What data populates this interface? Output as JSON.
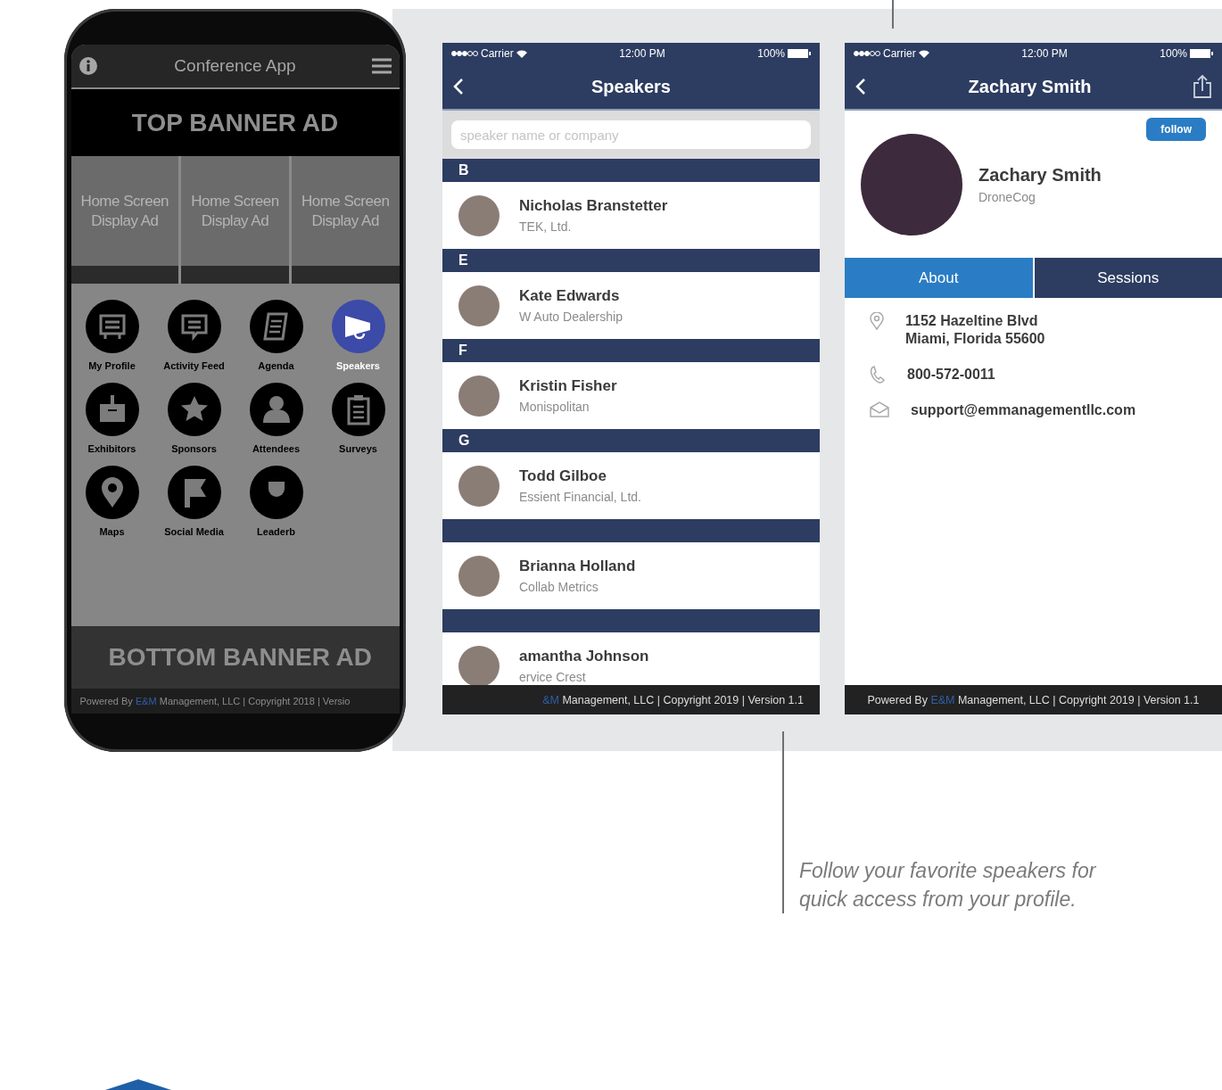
{
  "phone": {
    "header": {
      "title": "Conference App"
    },
    "top_banner": "TOP BANNER AD",
    "display_ads": [
      {
        "label": "Home Screen Display Ad"
      },
      {
        "label": "Home Screen Display Ad"
      },
      {
        "label": "Home Screen Display Ad"
      }
    ],
    "menu": [
      {
        "label": "My Profile",
        "selected": false
      },
      {
        "label": "Activity Feed",
        "selected": false
      },
      {
        "label": "Agenda",
        "selected": false
      },
      {
        "label": "Speakers",
        "selected": true
      },
      {
        "label": "Exhibitors",
        "selected": false
      },
      {
        "label": "Sponsors",
        "selected": false
      },
      {
        "label": "Attendees",
        "selected": false
      },
      {
        "label": "Surveys",
        "selected": false
      },
      {
        "label": "Maps",
        "selected": false
      },
      {
        "label": "Social Media",
        "selected": false
      },
      {
        "label": "Leaderb",
        "selected": false
      }
    ],
    "bottom_banner": "BOTTOM BANNER AD",
    "footer": {
      "before": "Powered By",
      "brand": "E&M",
      "after": "Management, LLC | Copyright 2018 | Versio"
    }
  },
  "speakers_screen": {
    "status_bar": {
      "carrier": "Carrier",
      "time": "12:00 PM",
      "battery": "100%"
    },
    "title": "Speakers",
    "search": {
      "placeholder": "speaker name or company"
    },
    "sections": [
      {
        "letter": "B",
        "speakers": [
          {
            "name": "Nicholas Branstetter",
            "company": "TEK, Ltd."
          }
        ]
      },
      {
        "letter": "E",
        "speakers": [
          {
            "name": "Kate Edwards",
            "company": "W Auto Dealership"
          }
        ]
      },
      {
        "letter": "F",
        "speakers": [
          {
            "name": "Kristin Fisher",
            "company": "Monispolitan"
          }
        ]
      },
      {
        "letter": "G",
        "speakers": [
          {
            "name": "Todd Gilboe",
            "company": "Essient Financial, Ltd."
          }
        ]
      },
      {
        "speakers": [
          {
            "name": "Brianna Holland",
            "company": "Collab Metrics"
          }
        ]
      },
      {
        "speakers": [
          {
            "name": "amantha Johnson",
            "company": "ervice Crest"
          }
        ]
      }
    ],
    "footer": {
      "brand": "&M",
      "after": "Management, LLC | Copyright 2019 | Version 1.1"
    }
  },
  "profile_screen": {
    "status_bar": {
      "carrier": "Carrier",
      "time": "12:00 PM",
      "battery": "100%"
    },
    "title": "Zachary Smith",
    "follow_button": "follow",
    "name": "Zachary Smith",
    "company": "DroneCog",
    "tabs": [
      {
        "label": "About",
        "selected": true
      },
      {
        "label": "Sessions",
        "selected": false
      }
    ],
    "contact": [
      {
        "kind": "address",
        "lines": [
          "1152 Hazeltine Blvd",
          "Miami, Florida 55600"
        ]
      },
      {
        "kind": "phone",
        "lines": [
          "800-572-0011"
        ]
      },
      {
        "kind": "email",
        "lines": [
          "support@emmanagementllc.com"
        ]
      }
    ],
    "footer": {
      "before": "Powered By",
      "brand": "E&M",
      "after": "Management, LLC | Copyright 2019 | Version 1.1"
    }
  },
  "caption": "Follow your favorite speakers for quick access from your profile."
}
